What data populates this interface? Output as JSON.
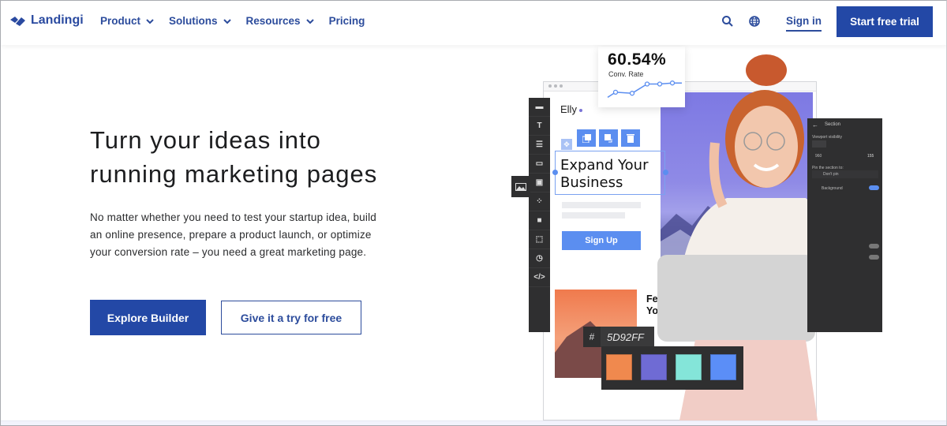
{
  "header": {
    "brand": "Landingi",
    "nav": [
      {
        "label": "Product",
        "has_dropdown": true
      },
      {
        "label": "Solutions",
        "has_dropdown": true
      },
      {
        "label": "Resources",
        "has_dropdown": true
      },
      {
        "label": "Pricing",
        "has_dropdown": false
      }
    ],
    "icons": [
      "search-icon",
      "globe-icon"
    ],
    "sign_in": "Sign in",
    "cta": "Start free trial"
  },
  "hero": {
    "title_line1": "Turn your ideas into",
    "title_line2": "running marketing pages",
    "lead_line1": "No matter whether you need to test your startup idea, build",
    "lead_line2": "an online presence, prepare a product launch, or optimize",
    "lead_line3": "your conversion rate – you need a great marketing page.",
    "primary_button": "Explore Builder",
    "secondary_button": "Give it a try for free"
  },
  "illustration": {
    "stat_value": "60.54%",
    "stat_label": "Conv. Rate",
    "stat_trend": [
      0.35,
      0.3,
      0.75,
      0.75,
      0.8
    ],
    "page_brand": "Elly",
    "headline_line1": "Expand Your",
    "headline_line2": "Business",
    "signup_label": "Sign Up",
    "teaser_line1": "Few",
    "teaser_line2": "You",
    "color_hash": "#",
    "color_value": "5D92FF",
    "swatches": [
      "#f0894e",
      "#6f6bd4",
      "#84e5d9",
      "#5b8ef7"
    ],
    "panel": {
      "title": "Section",
      "viewport_label": "Viewport visibility",
      "width_value": "960",
      "height_value": "155",
      "pin_label": "Pin the section to:",
      "pin_value": "Don't pin",
      "background_label": "Background"
    },
    "toolbar_tools": [
      "section-icon",
      "text-icon",
      "divider-icon",
      "button-icon",
      "image-icon",
      "shapes-icon",
      "video-icon",
      "box-icon",
      "timer-icon",
      "code-icon"
    ]
  },
  "colors": {
    "brand": "#2348a6",
    "accent": "#5b8ef0"
  }
}
